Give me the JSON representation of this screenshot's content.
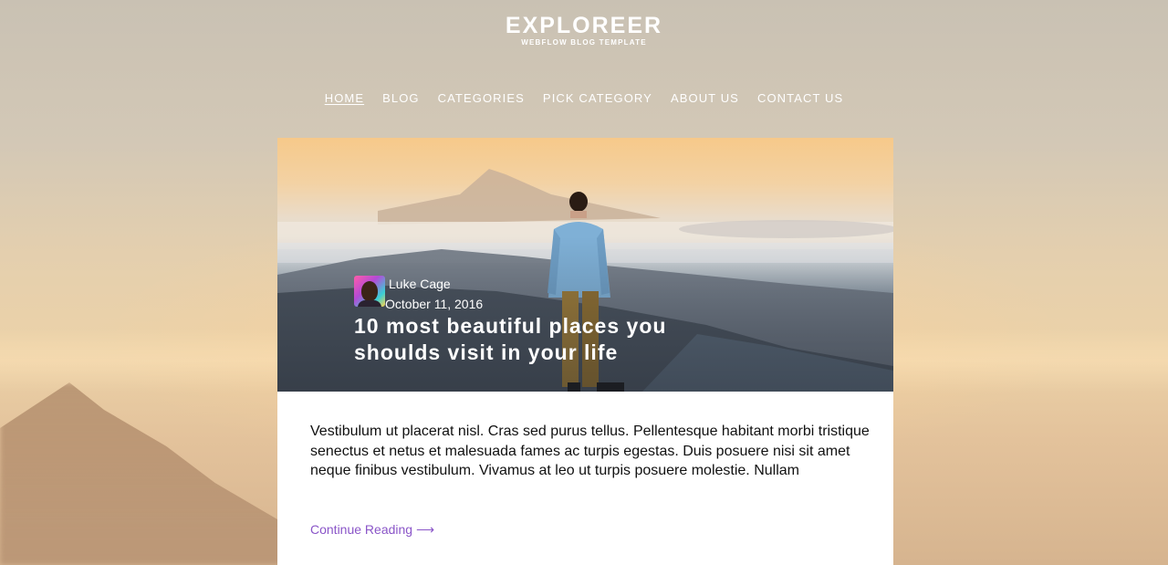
{
  "site": {
    "logo_title": "EXPLOREER",
    "logo_subtitle": "WEBFLOW BLOG TEMPLATE"
  },
  "nav": {
    "items": [
      {
        "label": "HOME",
        "active": true
      },
      {
        "label": "BLOG",
        "active": false
      },
      {
        "label": "CATEGORIES",
        "active": false
      },
      {
        "label": "PICK CATEGORY",
        "active": false
      },
      {
        "label": "ABOUT US",
        "active": false
      },
      {
        "label": "CONTACT US",
        "active": false
      }
    ]
  },
  "post": {
    "author_name": "Luke Cage",
    "date": "October 11, 2016",
    "title": "10 most beautiful places you shoulds visit in your life",
    "excerpt": "Vestibulum ut placerat nisl. Cras sed purus tellus. Pellentesque habitant morbi tristique senectus et netus et malesuada fames ac turpis egestas. Duis posuere nisi sit amet neque finibus vestibulum. Vivamus at leo ut turpis posuere molestie. Nullam",
    "continue_label": "Continue Reading ⟶"
  },
  "colors": {
    "link": "#8a55c8",
    "text": "#111111"
  }
}
